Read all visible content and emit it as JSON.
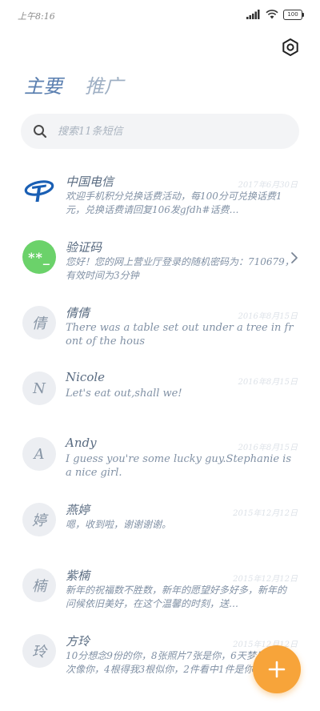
{
  "status_bar": {
    "time": "上午8:16",
    "battery": "100"
  },
  "tabs": [
    {
      "label": "主要",
      "active": true
    },
    {
      "label": "推广",
      "active": false
    }
  ],
  "search": {
    "placeholder": "搜索11条短信"
  },
  "conversations": [
    {
      "avatar": "telecom-logo-icon",
      "name": "中国电信",
      "time": "2017年6月30日",
      "preview": "欢迎手机积分兑换话费活动，每100分可兑换话费1元，兑换话费请回复106发gfdh#话费…"
    },
    {
      "avatar_text": "**_",
      "name": "验证码",
      "time": "",
      "preview": "您好！您的网上营业厅登录的随机密码为：710679，有效时间为3分钟"
    },
    {
      "avatar_text": "倩",
      "name": "倩倩",
      "time": "2016年8月15日",
      "preview": "There was a table set out under a tree in front of the hous"
    },
    {
      "avatar_text": "N",
      "name": "Nicole",
      "time": "2016年8月15日",
      "preview": "Let's eat out,shall we!"
    },
    {
      "avatar_text": "A",
      "name": "Andy",
      "time": "2016年8月15日",
      "preview": "I guess you're some lucky guy.Stephanie is a nice girl."
    },
    {
      "avatar_text": "婷",
      "name": "燕婷",
      "time": "2015年12月12日",
      "preview": "嗯，收到啦，谢谢谢谢。"
    },
    {
      "avatar_text": "楠",
      "name": "紫楠",
      "time": "2015年12月12日",
      "preview": "新年的祝福数不胜数，新年的愿望好多好多，新年的问候依旧美好，在这个温馨的时刻，送…"
    },
    {
      "avatar_text": "玲",
      "name": "方玲",
      "time": "2015年12月12日",
      "preview": "10分想念9份的你，8张照片7张是你，6天梦见你，5次像你，4根得我3根似你，2件看中1件是你。"
    }
  ],
  "colors": {
    "accent": "#5a7fb0",
    "fab": "#f7a43a",
    "green_avatar": "#6bd26a"
  },
  "icons": {
    "settings": "hexagon-gear-icon",
    "search": "search-icon",
    "fab": "plus-icon",
    "chevron": "chevron-right-icon"
  }
}
